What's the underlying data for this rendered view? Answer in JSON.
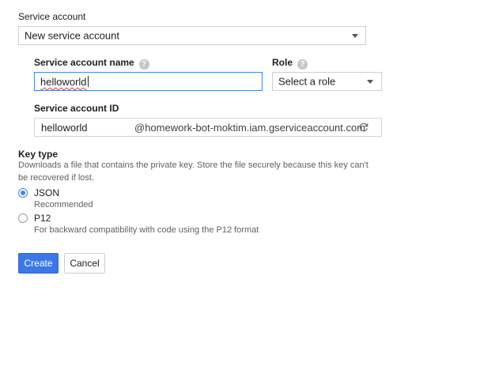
{
  "service_account": {
    "label": "Service account",
    "selected": "New service account"
  },
  "name_field": {
    "label": "Service account name",
    "value": "helloworld"
  },
  "role_field": {
    "label": "Role",
    "selected": "Select a role"
  },
  "id_field": {
    "label": "Service account ID",
    "value": "helloworld",
    "domain_suffix": "@homework-bot-moktim.iam.gserviceaccount.com"
  },
  "key_type": {
    "label": "Key type",
    "description_line1": "Downloads a file that contains the private key. Store the file securely because this key can't",
    "description_line2": "be recovered if lost.",
    "options": [
      {
        "label": "JSON",
        "sublabel": "Recommended",
        "checked": true
      },
      {
        "label": "P12",
        "sublabel": "For backward compatibility with code using the P12 format",
        "checked": false
      }
    ]
  },
  "actions": {
    "create_label": "Create",
    "cancel_label": "Cancel"
  },
  "colors": {
    "accent": "#4285f4",
    "primary_button": "#3b78e7"
  },
  "icons": {
    "help": "help-circle-icon",
    "dropdown": "chevron-down-icon",
    "refresh": "refresh-icon"
  }
}
